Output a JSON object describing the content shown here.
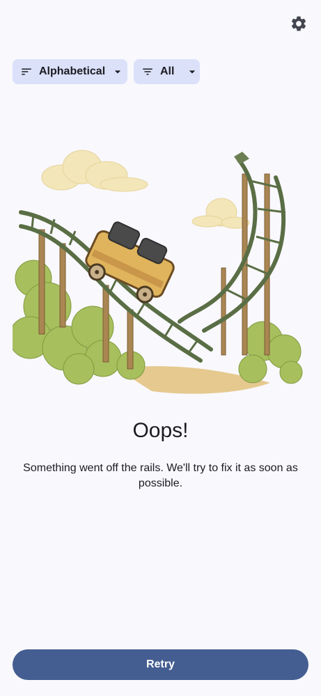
{
  "header": {
    "settings_icon": "gear-icon"
  },
  "filters": {
    "sort": {
      "icon": "sort-icon",
      "label": "Alphabetical",
      "arrow_icon": "dropdown-arrow-icon"
    },
    "filter": {
      "icon": "filter-icon",
      "label": "All",
      "arrow_icon": "dropdown-arrow-icon"
    }
  },
  "error": {
    "illustration": "broken-rollercoaster-illustration",
    "title": "Oops!",
    "message": "Something went off the rails. We'll try to fix it as soon as possible."
  },
  "actions": {
    "retry_label": "Retry"
  },
  "colors": {
    "background": "#f9f8fd",
    "chip_background": "#dbe1f9",
    "primary": "#445e91",
    "text": "#1b1b21"
  }
}
